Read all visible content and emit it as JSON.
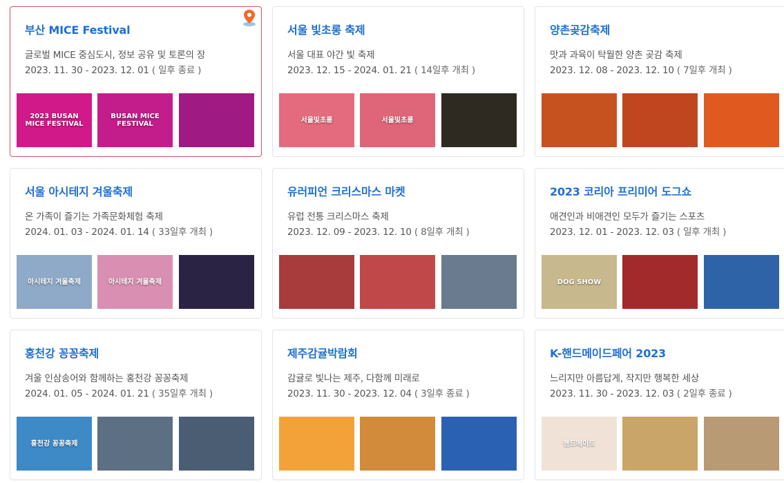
{
  "festivals": [
    {
      "title": "부산 MICE Festival",
      "desc": "글로벌 MICE 중심도시, 정보 공유 및 토론의 장",
      "date": "2023. 11. 30 - 2023. 12. 01",
      "status": "( 일후 종료 )",
      "thumbs": [
        {
          "text": "2023 BUSAN MICE FESTIVAL",
          "bg": "#d2198a"
        },
        {
          "text": "BUSAN MICE FESTIVAL",
          "bg": "#c31d8c"
        },
        {
          "text": "",
          "bg": "#a01a84"
        }
      ]
    },
    {
      "title": "서울 빛초롱 축제",
      "desc": "서울 대표 야간 빛 축제",
      "date": "2023. 12. 15 - 2024. 01. 21",
      "status": "( 14일후 개최 )",
      "thumbs": [
        {
          "text": "서울빛초롱",
          "bg": "#e46a7d"
        },
        {
          "text": "서울빛초롱",
          "bg": "#df6678"
        },
        {
          "text": "",
          "bg": "#2e2a22"
        }
      ]
    },
    {
      "title": "양촌곶감축제",
      "desc": "맛과 과육이 탁월한 양촌 곶감 축제",
      "date": "2023. 12. 08 - 2023. 12. 10",
      "status": "( 7일후 개최 )",
      "thumbs": [
        {
          "text": "",
          "bg": "#c6531f"
        },
        {
          "text": "",
          "bg": "#c0461f"
        },
        {
          "text": "",
          "bg": "#e05a20"
        }
      ]
    },
    {
      "title": "서울 아시테지 겨울축제",
      "desc": "온 가족이 즐기는 가족문화체험 축제",
      "date": "2024. 01. 03 - 2024. 01. 14",
      "status": "( 33일후 개최 )",
      "thumbs": [
        {
          "text": "아시테지 겨울축제",
          "bg": "#8fa9c9"
        },
        {
          "text": "아시테지 겨울축제",
          "bg": "#d98fb2"
        },
        {
          "text": "",
          "bg": "#2b2344"
        }
      ]
    },
    {
      "title": "유러피언 크리스마스 마켓",
      "desc": "유럽 전통 크리스마스 축제",
      "date": "2023. 12. 09 - 2023. 12. 10",
      "status": "( 8일후 개최 )",
      "thumbs": [
        {
          "text": "",
          "bg": "#a83b3b"
        },
        {
          "text": "",
          "bg": "#c14848"
        },
        {
          "text": "",
          "bg": "#6a7b90"
        }
      ]
    },
    {
      "title": "2023 코리아 프리미어 도그쇼",
      "desc": "애견인과 비애견인 모두가 즐기는 스포츠",
      "date": "2023. 12. 01 - 2023. 12. 03",
      "status": "( 일후 개최 )",
      "thumbs": [
        {
          "text": "DOG SHOW",
          "bg": "#c8b88e"
        },
        {
          "text": "",
          "bg": "#a22a2a"
        },
        {
          "text": "",
          "bg": "#2f63a8"
        }
      ]
    },
    {
      "title": "홍천강 꽁꽁축제",
      "desc": "겨울 인삼송어와 함께하는 홍천강 꽁꽁축제",
      "date": "2024. 01. 05 - 2024. 01. 21",
      "status": "( 35일후 개최 )",
      "thumbs": [
        {
          "text": "홍천강 꽁꽁축제",
          "bg": "#3d8ac7"
        },
        {
          "text": "",
          "bg": "#5d6f82"
        },
        {
          "text": "",
          "bg": "#4b5d72"
        }
      ]
    },
    {
      "title": "제주감귤박람회",
      "desc": "감귤로 빛나는 제주, 다함께 미래로",
      "date": "2023. 11. 30 - 2023. 12. 04",
      "status": "( 3일후 종료 )",
      "thumbs": [
        {
          "text": "",
          "bg": "#f3a23a"
        },
        {
          "text": "",
          "bg": "#d28b3a"
        },
        {
          "text": "",
          "bg": "#2b61b3"
        }
      ]
    },
    {
      "title": "K-핸드메이드페어 2023",
      "desc": "느리지만 아름답게, 작지만 행복한 세상",
      "date": "2023. 11. 30 - 2023. 12. 03",
      "status": "( 2일후 종료 )",
      "thumbs": [
        {
          "text": "핸드메이드",
          "bg": "#f0e2d6"
        },
        {
          "text": "",
          "bg": "#c9a56a"
        },
        {
          "text": "",
          "bg": "#b89a74"
        }
      ]
    }
  ],
  "icons": {
    "selected_card_badge": "location-pin-icon"
  },
  "colors": {
    "title": "#1f6fd1",
    "selected_border": "#e0505a",
    "pin": "#f26a2e"
  }
}
